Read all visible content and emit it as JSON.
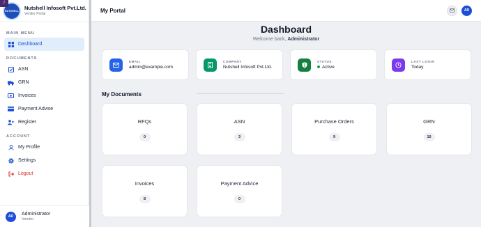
{
  "brand": {
    "name": "Nutshell Infosoft Pvt.Ltd.",
    "role": "Vendor Portal",
    "logo_text": "NUTSHELL",
    "corner_glyph": "┘"
  },
  "sidebar": {
    "sections": {
      "main": "MAIN MENU",
      "documents": "DOCUMENTS",
      "account": "ACCOUNT"
    },
    "items": {
      "dashboard": "Dashboard",
      "asn": "ASN",
      "grn": "GRN",
      "invoices": "Invoices",
      "payment_advise": "Payment Advise",
      "register": "Register",
      "my_profile": "My Profile",
      "settings": "Settings",
      "logout": "Logout"
    }
  },
  "user": {
    "initials": "AD",
    "name": "Administrator",
    "role": "Vendor"
  },
  "topbar": {
    "title": "My Portal",
    "avatar": "AD"
  },
  "heading": {
    "title": "Dashboard",
    "welcome": "Welcome back,",
    "user": "Administrator"
  },
  "info_cards": [
    {
      "label": "EMAIL",
      "value": "admin@example.com",
      "color": "#2563eb"
    },
    {
      "label": "COMPANY",
      "value": "Nutshell Infosoft Pvt.Ltd.",
      "color": "#059669"
    },
    {
      "label": "STATUS",
      "value": "Active",
      "color": "#15803d"
    },
    {
      "label": "LAST LOGIN",
      "value": "Today",
      "color": "#7c3aed"
    }
  ],
  "documents": {
    "title": "My Documents",
    "cards": [
      {
        "name": "RFQs",
        "count": "0"
      },
      {
        "name": "ASN",
        "count": "3"
      },
      {
        "name": "Purchase Orders",
        "count": "9"
      },
      {
        "name": "GRN",
        "count": "10"
      },
      {
        "name": "Invoices",
        "count": "8"
      },
      {
        "name": "Payment Advice",
        "count": "0"
      }
    ]
  }
}
